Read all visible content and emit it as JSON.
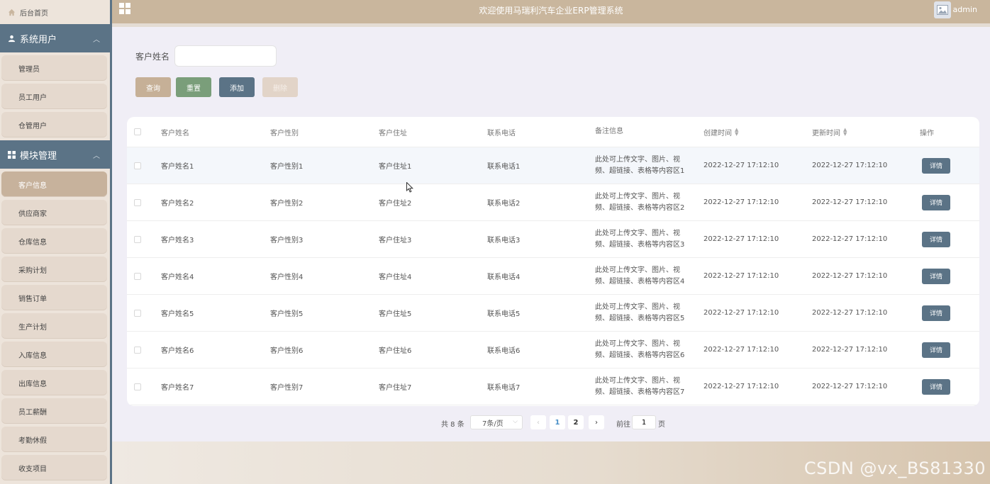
{
  "sidebar": {
    "home_label": "后台首页",
    "groups": [
      {
        "title": "系统用户",
        "items": [
          "管理员",
          "员工用户",
          "仓管用户"
        ]
      },
      {
        "title": "模块管理",
        "items": [
          "客户信息",
          "供应商家",
          "仓库信息",
          "采购计划",
          "销售订单",
          "生产计划",
          "入库信息",
          "出库信息",
          "员工薪酬",
          "考勤休假",
          "收支项目"
        ]
      }
    ],
    "active_item": "客户信息"
  },
  "header": {
    "title": "欢迎使用马瑞利汽车企业ERP管理系统",
    "user": "admin"
  },
  "search": {
    "label": "客户姓名",
    "value": "",
    "placeholder": ""
  },
  "actions": {
    "search": "查询",
    "reset": "重置",
    "add": "添加",
    "delete": "删除"
  },
  "table": {
    "columns": [
      "客户姓名",
      "客户性别",
      "客户住址",
      "联系电话",
      "备注信息",
      "创建时间",
      "更新时间",
      "操作"
    ],
    "rows": [
      {
        "name": "客户姓名1",
        "sex": "客户性别1",
        "addr": "客户住址1",
        "phone": "联系电话1",
        "note": "此处可上传文字、图片、视频、超链接、表格等内容区1",
        "created": "2022-12-27 17:12:10",
        "updated": "2022-12-27 17:12:10",
        "op": "详情"
      },
      {
        "name": "客户姓名2",
        "sex": "客户性别2",
        "addr": "客户住址2",
        "phone": "联系电话2",
        "note": "此处可上传文字、图片、视频、超链接、表格等内容区2",
        "created": "2022-12-27 17:12:10",
        "updated": "2022-12-27 17:12:10",
        "op": "详情"
      },
      {
        "name": "客户姓名3",
        "sex": "客户性别3",
        "addr": "客户住址3",
        "phone": "联系电话3",
        "note": "此处可上传文字、图片、视频、超链接、表格等内容区3",
        "created": "2022-12-27 17:12:10",
        "updated": "2022-12-27 17:12:10",
        "op": "详情"
      },
      {
        "name": "客户姓名4",
        "sex": "客户性别4",
        "addr": "客户住址4",
        "phone": "联系电话4",
        "note": "此处可上传文字、图片、视频、超链接、表格等内容区4",
        "created": "2022-12-27 17:12:10",
        "updated": "2022-12-27 17:12:10",
        "op": "详情"
      },
      {
        "name": "客户姓名5",
        "sex": "客户性别5",
        "addr": "客户住址5",
        "phone": "联系电话5",
        "note": "此处可上传文字、图片、视频、超链接、表格等内容区5",
        "created": "2022-12-27 17:12:10",
        "updated": "2022-12-27 17:12:10",
        "op": "详情"
      },
      {
        "name": "客户姓名6",
        "sex": "客户性别6",
        "addr": "客户住址6",
        "phone": "联系电话6",
        "note": "此处可上传文字、图片、视频、超链接、表格等内容区6",
        "created": "2022-12-27 17:12:10",
        "updated": "2022-12-27 17:12:10",
        "op": "详情"
      },
      {
        "name": "客户姓名7",
        "sex": "客户性别7",
        "addr": "客户住址7",
        "phone": "联系电话7",
        "note": "此处可上传文字、图片、视频、超链接、表格等内容区7",
        "created": "2022-12-27 17:12:10",
        "updated": "2022-12-27 17:12:10",
        "op": "详情"
      }
    ]
  },
  "pagination": {
    "total": "共 8 条",
    "page_size": "7条/页",
    "pages": [
      "1",
      "2"
    ],
    "current": "1",
    "goto_label": "前往",
    "goto_value": "1",
    "goto_unit": "页"
  },
  "watermark": "CSDN @vx_BS81330",
  "colors": {
    "sidebar_group": "#5b7386",
    "header": "#c9b69d",
    "active_item": "#c7b29c",
    "reset_button": "#7a9e7a",
    "detail_button": "#5b7386"
  }
}
